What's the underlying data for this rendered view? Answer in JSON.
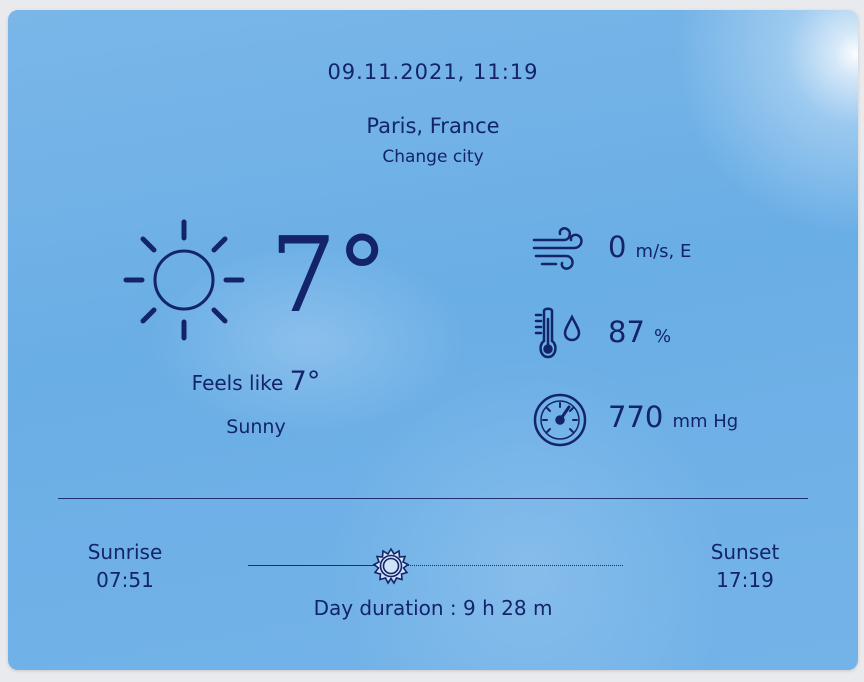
{
  "header": {
    "datetime": "09.11.2021, 11:19",
    "city": "Paris, France",
    "change_city": "Change city"
  },
  "current": {
    "icon": "sun-icon",
    "temperature": "7°",
    "feels_like_label": "Feels like",
    "feels_like_value": "7°",
    "condition": "Sunny"
  },
  "metrics": {
    "wind": {
      "icon": "wind-icon",
      "value": "0",
      "unit": "m/s, E"
    },
    "humidity": {
      "icon": "thermometer-drop-icon",
      "value": "87",
      "unit": "%"
    },
    "pressure": {
      "icon": "barometer-icon",
      "value": "770",
      "unit": "mm Hg"
    }
  },
  "sun": {
    "sunrise_label": "Sunrise",
    "sunrise_time": "07:51",
    "sunset_label": "Sunset",
    "sunset_time": "17:19",
    "day_duration": "Day duration : 9 h 28 m",
    "marker_icon": "sun-position-icon"
  },
  "colors": {
    "text": "#13246b",
    "sky": "#6aaee6"
  }
}
